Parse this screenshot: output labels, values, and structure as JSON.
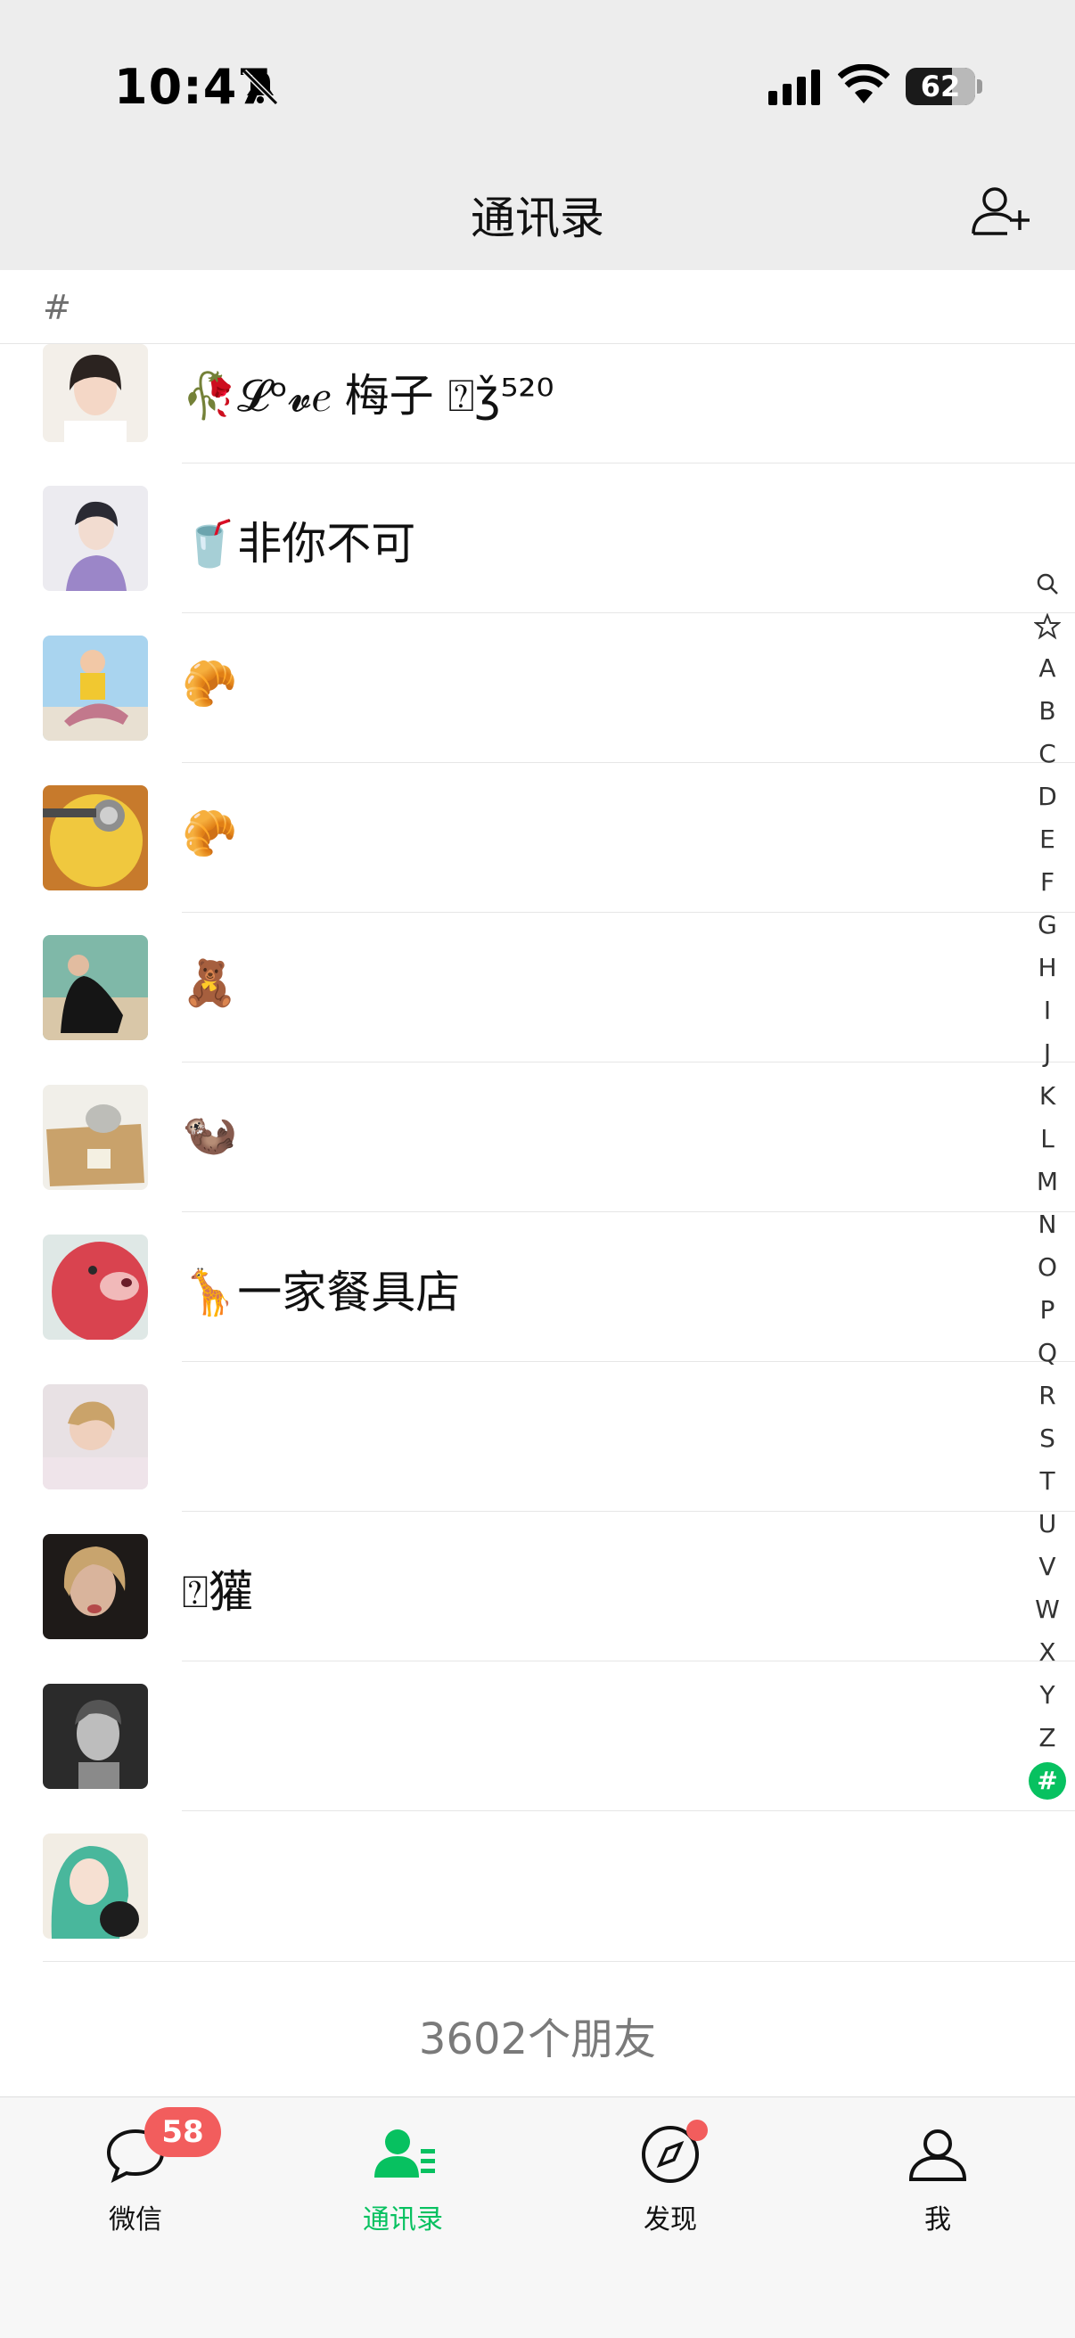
{
  "status_bar": {
    "time": "10:47",
    "battery": "62"
  },
  "nav": {
    "title": "通讯录"
  },
  "section": {
    "letter": "#"
  },
  "contacts": [
    {
      "name": "🥀𝓛ᵒ𝓿𝑒 梅子 ⍰ǯ⁵²⁰"
    },
    {
      "name": "🥤非你不可"
    },
    {
      "name": "🥐"
    },
    {
      "name": "🥐"
    },
    {
      "name": "🧸"
    },
    {
      "name": "🦦"
    },
    {
      "name": "🦒一家餐具店"
    },
    {
      "name": ""
    },
    {
      "name": "⍰獾"
    },
    {
      "name": ""
    },
    {
      "name": ""
    }
  ],
  "index": [
    "A",
    "B",
    "C",
    "D",
    "E",
    "F",
    "G",
    "H",
    "I",
    "J",
    "K",
    "L",
    "M",
    "N",
    "O",
    "P",
    "Q",
    "R",
    "S",
    "T",
    "U",
    "V",
    "W",
    "X",
    "Y",
    "Z",
    "#"
  ],
  "footer": {
    "friend_count": "3602个朋友"
  },
  "tabs": [
    {
      "label": "微信",
      "badge": "58"
    },
    {
      "label": "通讯录"
    },
    {
      "label": "发现"
    },
    {
      "label": "我"
    }
  ],
  "colors": {
    "accent": "#07c160",
    "badge": "#f25d5d",
    "header_bg": "#ededed"
  }
}
